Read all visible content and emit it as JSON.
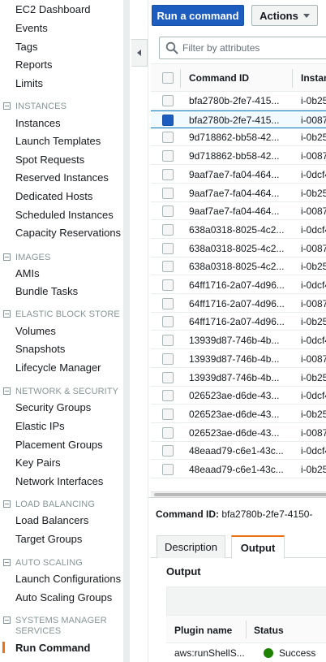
{
  "sidebar": {
    "top_items": [
      "EC2 Dashboard",
      "Events",
      "Tags",
      "Reports",
      "Limits"
    ],
    "sections": [
      {
        "title": "INSTANCES",
        "items": [
          "Instances",
          "Launch Templates",
          "Spot Requests",
          "Reserved Instances",
          "Dedicated Hosts",
          "Scheduled Instances",
          "Capacity Reservations"
        ]
      },
      {
        "title": "IMAGES",
        "items": [
          "AMIs",
          "Bundle Tasks"
        ]
      },
      {
        "title": "ELASTIC BLOCK STORE",
        "items": [
          "Volumes",
          "Snapshots",
          "Lifecycle Manager"
        ]
      },
      {
        "title": "NETWORK & SECURITY",
        "items": [
          "Security Groups",
          "Elastic IPs",
          "Placement Groups",
          "Key Pairs",
          "Network Interfaces"
        ]
      },
      {
        "title": "LOAD BALANCING",
        "items": [
          "Load Balancers",
          "Target Groups"
        ]
      },
      {
        "title": "AUTO SCALING",
        "items": [
          "Launch Configurations",
          "Auto Scaling Groups"
        ]
      },
      {
        "title_lines": [
          "SYSTEMS MANAGER",
          "SERVICES"
        ],
        "items": [
          "Run Command"
        ],
        "active": "Run Command"
      }
    ]
  },
  "toolbar": {
    "run_command_label": "Run a command",
    "actions_label": "Actions"
  },
  "filter": {
    "placeholder": "Filter by attributes"
  },
  "table": {
    "columns": [
      "Command ID",
      "Instan"
    ],
    "rows": [
      {
        "command_id": "bfa2780b-2fe7-415...",
        "instance": "i-0b25",
        "selected": false
      },
      {
        "command_id": "bfa2780b-2fe7-415...",
        "instance": "i-0087",
        "selected": true
      },
      {
        "command_id": "9d718862-bb58-42...",
        "instance": "i-0b25",
        "selected": false
      },
      {
        "command_id": "9d718862-bb58-42...",
        "instance": "i-0087",
        "selected": false
      },
      {
        "command_id": "9aaf7ae7-fa04-464...",
        "instance": "i-0dcf4",
        "selected": false
      },
      {
        "command_id": "9aaf7ae7-fa04-464...",
        "instance": "i-0b25",
        "selected": false
      },
      {
        "command_id": "9aaf7ae7-fa04-464...",
        "instance": "i-0087",
        "selected": false
      },
      {
        "command_id": "638a0318-8025-4c2...",
        "instance": "i-0dcf4",
        "selected": false
      },
      {
        "command_id": "638a0318-8025-4c2...",
        "instance": "i-0087",
        "selected": false
      },
      {
        "command_id": "638a0318-8025-4c2...",
        "instance": "i-0b25",
        "selected": false
      },
      {
        "command_id": "64ff1716-2a07-4d96...",
        "instance": "i-0dcf4",
        "selected": false
      },
      {
        "command_id": "64ff1716-2a07-4d96...",
        "instance": "i-0087",
        "selected": false
      },
      {
        "command_id": "64ff1716-2a07-4d96...",
        "instance": "i-0b25",
        "selected": false
      },
      {
        "command_id": "13939d87-746b-4b...",
        "instance": "i-0dcf4",
        "selected": false
      },
      {
        "command_id": "13939d87-746b-4b...",
        "instance": "i-0087",
        "selected": false
      },
      {
        "command_id": "13939d87-746b-4b...",
        "instance": "i-0b25",
        "selected": false
      },
      {
        "command_id": "026523ae-d6de-43...",
        "instance": "i-0dcf4",
        "selected": false
      },
      {
        "command_id": "026523ae-d6de-43...",
        "instance": "i-0b25",
        "selected": false
      },
      {
        "command_id": "026523ae-d6de-43...",
        "instance": "i-0087",
        "selected": false
      },
      {
        "command_id": "48eaad79-c6e1-43c...",
        "instance": "i-0dcf4",
        "selected": false
      },
      {
        "command_id": "48eaad79-c6e1-43c...",
        "instance": "i-0b25",
        "selected": false
      }
    ]
  },
  "detail": {
    "command_id_label": "Command ID:",
    "command_id_value": "bfa2780b-2fe7-4150-",
    "tabs": [
      "Description",
      "Output"
    ],
    "active_tab": "Output",
    "output_label": "Output",
    "output_columns": [
      "Plugin name",
      "Status"
    ],
    "output_rows": [
      {
        "plugin": "aws:runShellS...",
        "status": "Success"
      }
    ]
  },
  "colors": {
    "primary_button": "#1d5dbf",
    "active_accent": "#ec7211",
    "success": "#1d8102"
  }
}
